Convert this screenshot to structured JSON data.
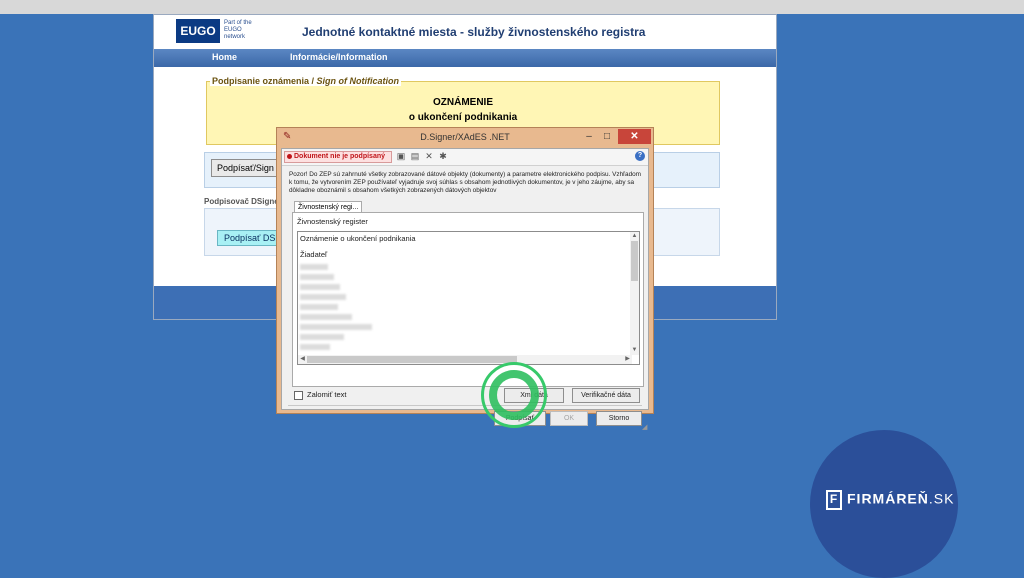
{
  "site": {
    "logo_box": "EUGO",
    "logo_caption": "Part of the EUGO network",
    "title": "Jednotné kontaktné miesta - služby živnostenského registra",
    "nav": [
      "Home",
      "Informácie/Information"
    ]
  },
  "form": {
    "legend_sk": "Podpisanie oznámenia /",
    "legend_en": "Sign of Notification",
    "notice_title": "OZNÁMENIE",
    "notice_subtitle": "o ukončení podnikania",
    "sign_button": "Podpísať/Sign",
    "dsigner_label": "Podpisovač DSigner",
    "dsigner_button": "Podpísať DSigner"
  },
  "dialog": {
    "title": "D.Signer/XAdES .NET",
    "status": "Dokument nie je podpísaný",
    "warning": "Pozor! Do ZEP sú zahrnuté všetky zobrazované dátové objekty (dokumenty) a parametre elektronického podpisu. Vzhľadom k tomu, že vytvorením ZEP používateľ vyjadruje svoj súhlas s obsahom jednotlivých dokumentov, je v jeho záujme, aby sa dôkladne oboznámil s obsahom všetkých zobrazených dátových objektov",
    "tab": "Živnostenský regi...",
    "panel_label": "Živnostenský register",
    "content_lines": [
      "Oznámenie o ukončení podnikania",
      "Žiadateľ"
    ],
    "wrap_label": "Zalomiť text",
    "btn_xml": "Xml dáta",
    "btn_verify": "Verifikačné dáta",
    "btn_sign": "Podpísať",
    "btn_ok": "OK",
    "btn_cancel": "Storno"
  },
  "brand": {
    "icon_letter": "F",
    "name": "FIRMÁREŇ",
    "suffix": ".SK"
  },
  "colors": {
    "desktop": "#3a73b8",
    "dialog_frame": "#e8b98f",
    "close_button": "#c8453a",
    "highlight": "#37c96a"
  }
}
